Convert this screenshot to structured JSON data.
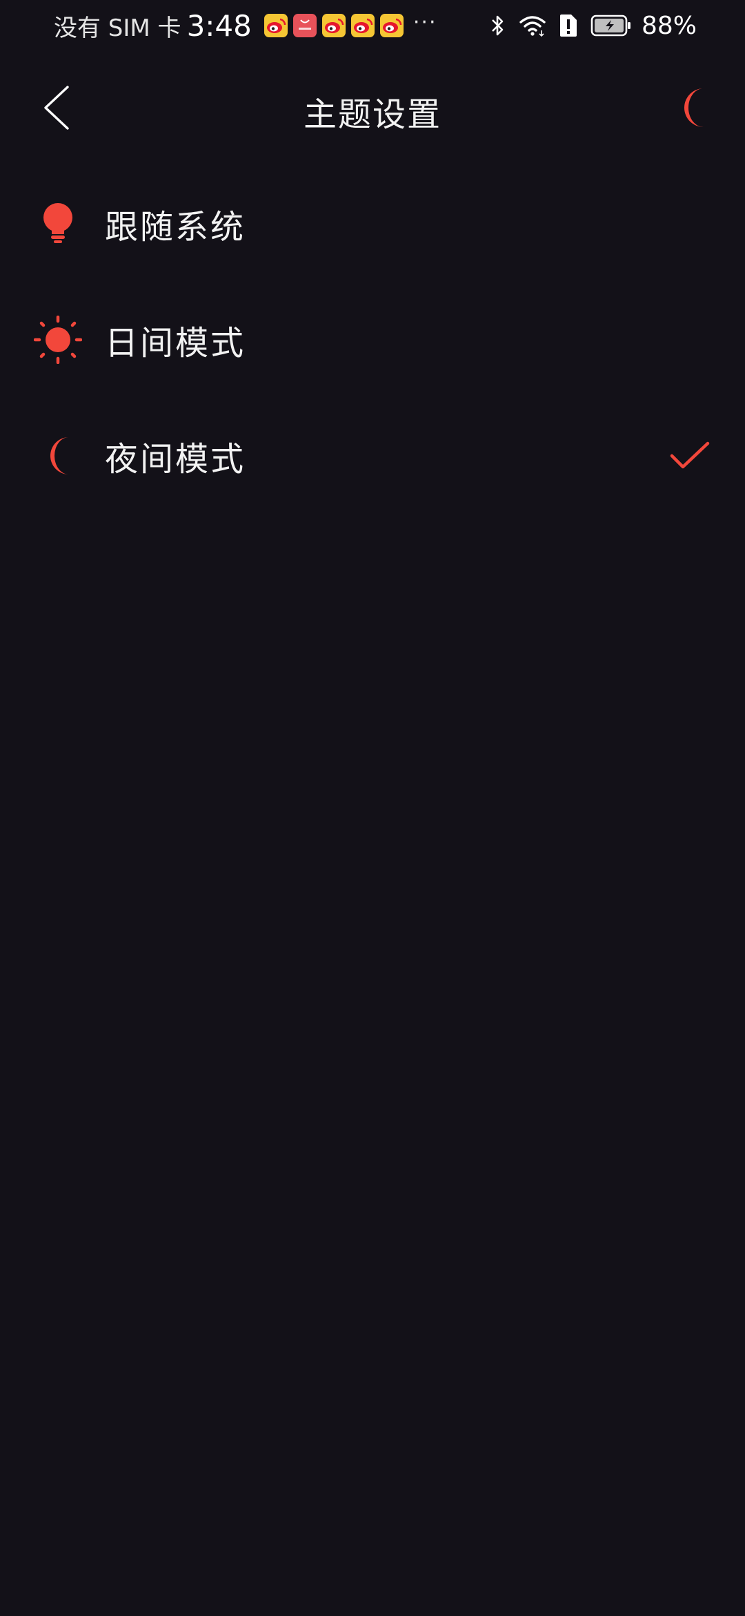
{
  "status_bar": {
    "carrier": "没有 SIM 卡",
    "time": "3:48",
    "notification_icons": [
      "weibo-icon",
      "huawei-appgallery-icon",
      "weibo-icon",
      "weibo-icon",
      "weibo-icon"
    ],
    "more": "···",
    "battery_percent": "88%"
  },
  "header": {
    "title": "主题设置"
  },
  "options": [
    {
      "label": "跟随系统",
      "icon": "lightbulb-icon",
      "selected": false
    },
    {
      "label": "日间模式",
      "icon": "sun-icon",
      "selected": false
    },
    {
      "label": "夜间模式",
      "icon": "moon-icon",
      "selected": true
    }
  ],
  "colors": {
    "background": "#131118",
    "accent": "#f2473b",
    "text": "#f2f2f2"
  }
}
